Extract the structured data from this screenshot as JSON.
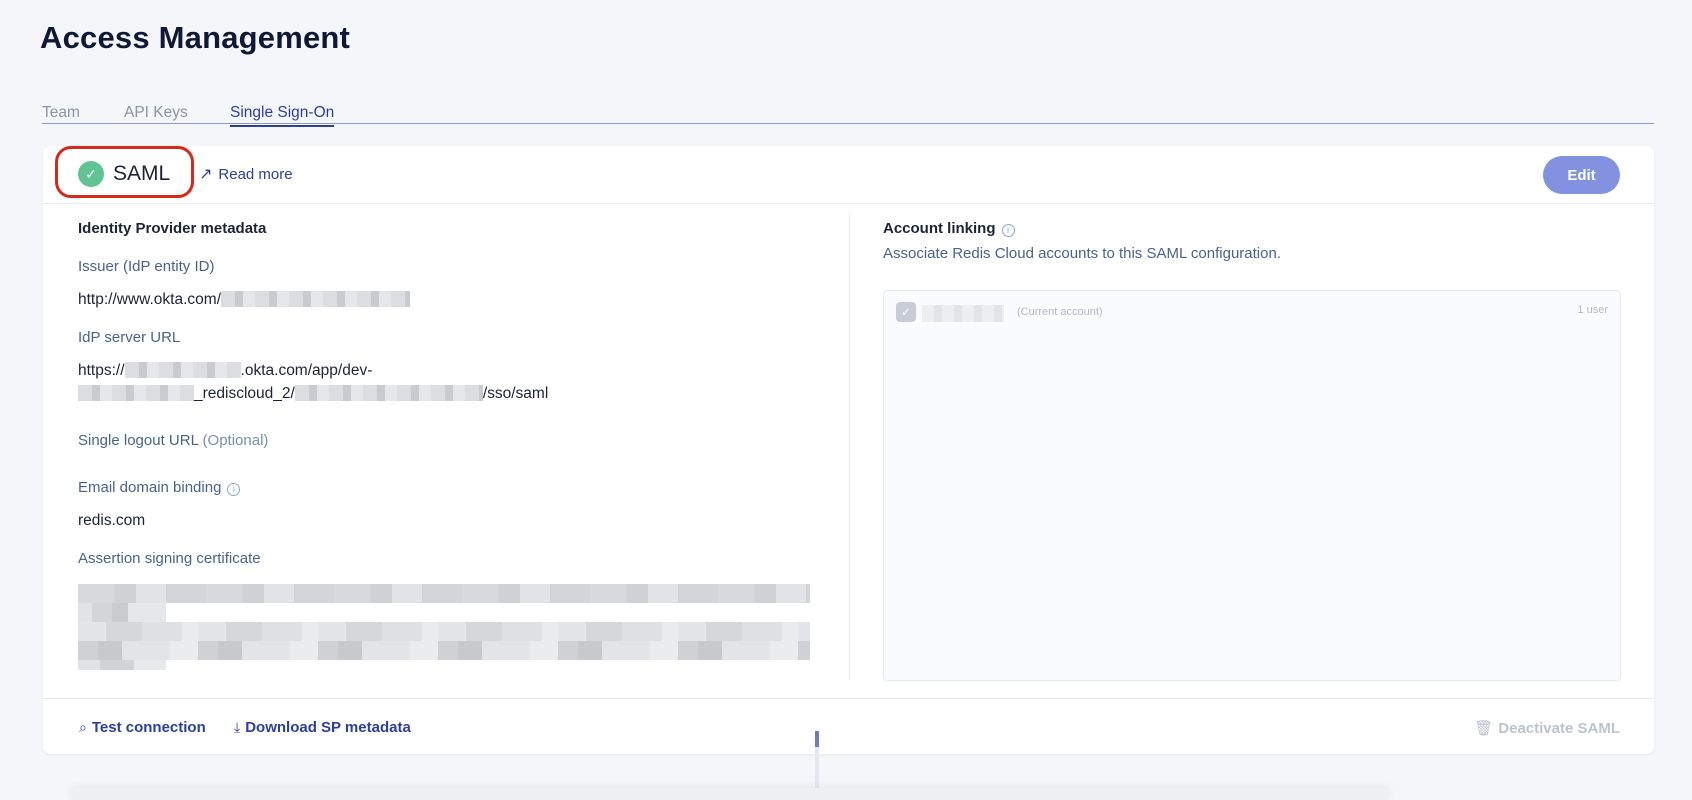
{
  "page": {
    "title": "Access Management"
  },
  "tabs": [
    {
      "label": "Team",
      "active": false
    },
    {
      "label": "API Keys",
      "active": false
    },
    {
      "label": "Single Sign-On",
      "active": true
    }
  ],
  "header": {
    "title": "SAML",
    "read_more": "Read more",
    "edit_label": "Edit",
    "status_icon": "check-icon",
    "status_color": "#5fc393",
    "highlight_color": "#d9281a"
  },
  "idp": {
    "heading": "Identity Provider metadata",
    "issuer_label": "Issuer (IdP entity ID)",
    "issuer_value_prefix": "http://www.okta.com/",
    "server_url_label": "IdP server URL",
    "server_url_line1_prefix": "https://",
    "server_url_line1_suffix": ".okta.com/app/dev-",
    "server_url_line2_mid": "_rediscloud_2/",
    "server_url_line2_suffix": "/sso/saml",
    "logout_label": "Single logout URL",
    "logout_optional": "(Optional)",
    "email_binding_label": "Email domain binding",
    "email_binding_value": "redis.com",
    "cert_label": "Assertion signing certificate"
  },
  "account_linking": {
    "heading": "Account linking",
    "description": "Associate Redis Cloud accounts to this SAML configuration.",
    "account_current": "(Current account)",
    "account_users": "1 user"
  },
  "footer": {
    "test_connection": "Test connection",
    "download_metadata": "Download SP metadata",
    "deactivate": "Deactivate SAML"
  },
  "colors": {
    "accent": "#2c3f9e",
    "edit_button": "#8291e0",
    "label": "#4a6489"
  }
}
